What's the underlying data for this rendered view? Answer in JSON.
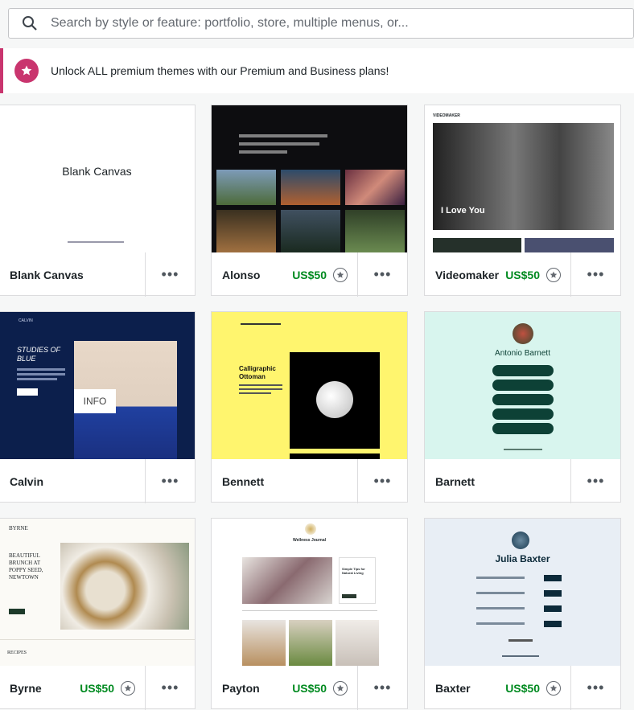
{
  "search": {
    "placeholder": "Search by style or feature: portfolio, store, multiple menus, or..."
  },
  "banner": {
    "text": "Unlock ALL premium themes with our Premium and Business plans!"
  },
  "colors": {
    "accent": "#c9356e",
    "price": "#008a20"
  },
  "themes": [
    {
      "name": "Blank Canvas",
      "price": "",
      "more": "•••",
      "thumb_title": "Blank Canvas"
    },
    {
      "name": "Alonso",
      "price": "US$50",
      "more": "•••"
    },
    {
      "name": "Videomaker",
      "price": "US$50",
      "more": "•••",
      "thumb_overlay": "I Love You",
      "thumb_brand": "VIDEOMAKER"
    },
    {
      "name": "Calvin",
      "price": "",
      "more": "•••",
      "thumb_heading": "STUDIES OF BLUE",
      "thumb_info": "INFO",
      "thumb_brand": "CALVIN"
    },
    {
      "name": "Bennett",
      "price": "",
      "more": "•••",
      "thumb_heading": "Calligraphic Ottoman"
    },
    {
      "name": "Barnett",
      "price": "",
      "more": "•••",
      "thumb_heading": "Antonio Barnett"
    },
    {
      "name": "Byrne",
      "price": "US$50",
      "more": "•••",
      "thumb_brand": "BYRNE",
      "thumb_heading": "BEAUTIFUL BRUNCH AT POPPY SEED, NEWTOWN",
      "thumb_section": "RECIPES"
    },
    {
      "name": "Payton",
      "price": "US$50",
      "more": "•••",
      "thumb_brand": "Wellness Journal",
      "thumb_heading": "Simple Tips for Natural Living"
    },
    {
      "name": "Baxter",
      "price": "US$50",
      "more": "•••",
      "thumb_heading": "Julia Baxter"
    }
  ]
}
